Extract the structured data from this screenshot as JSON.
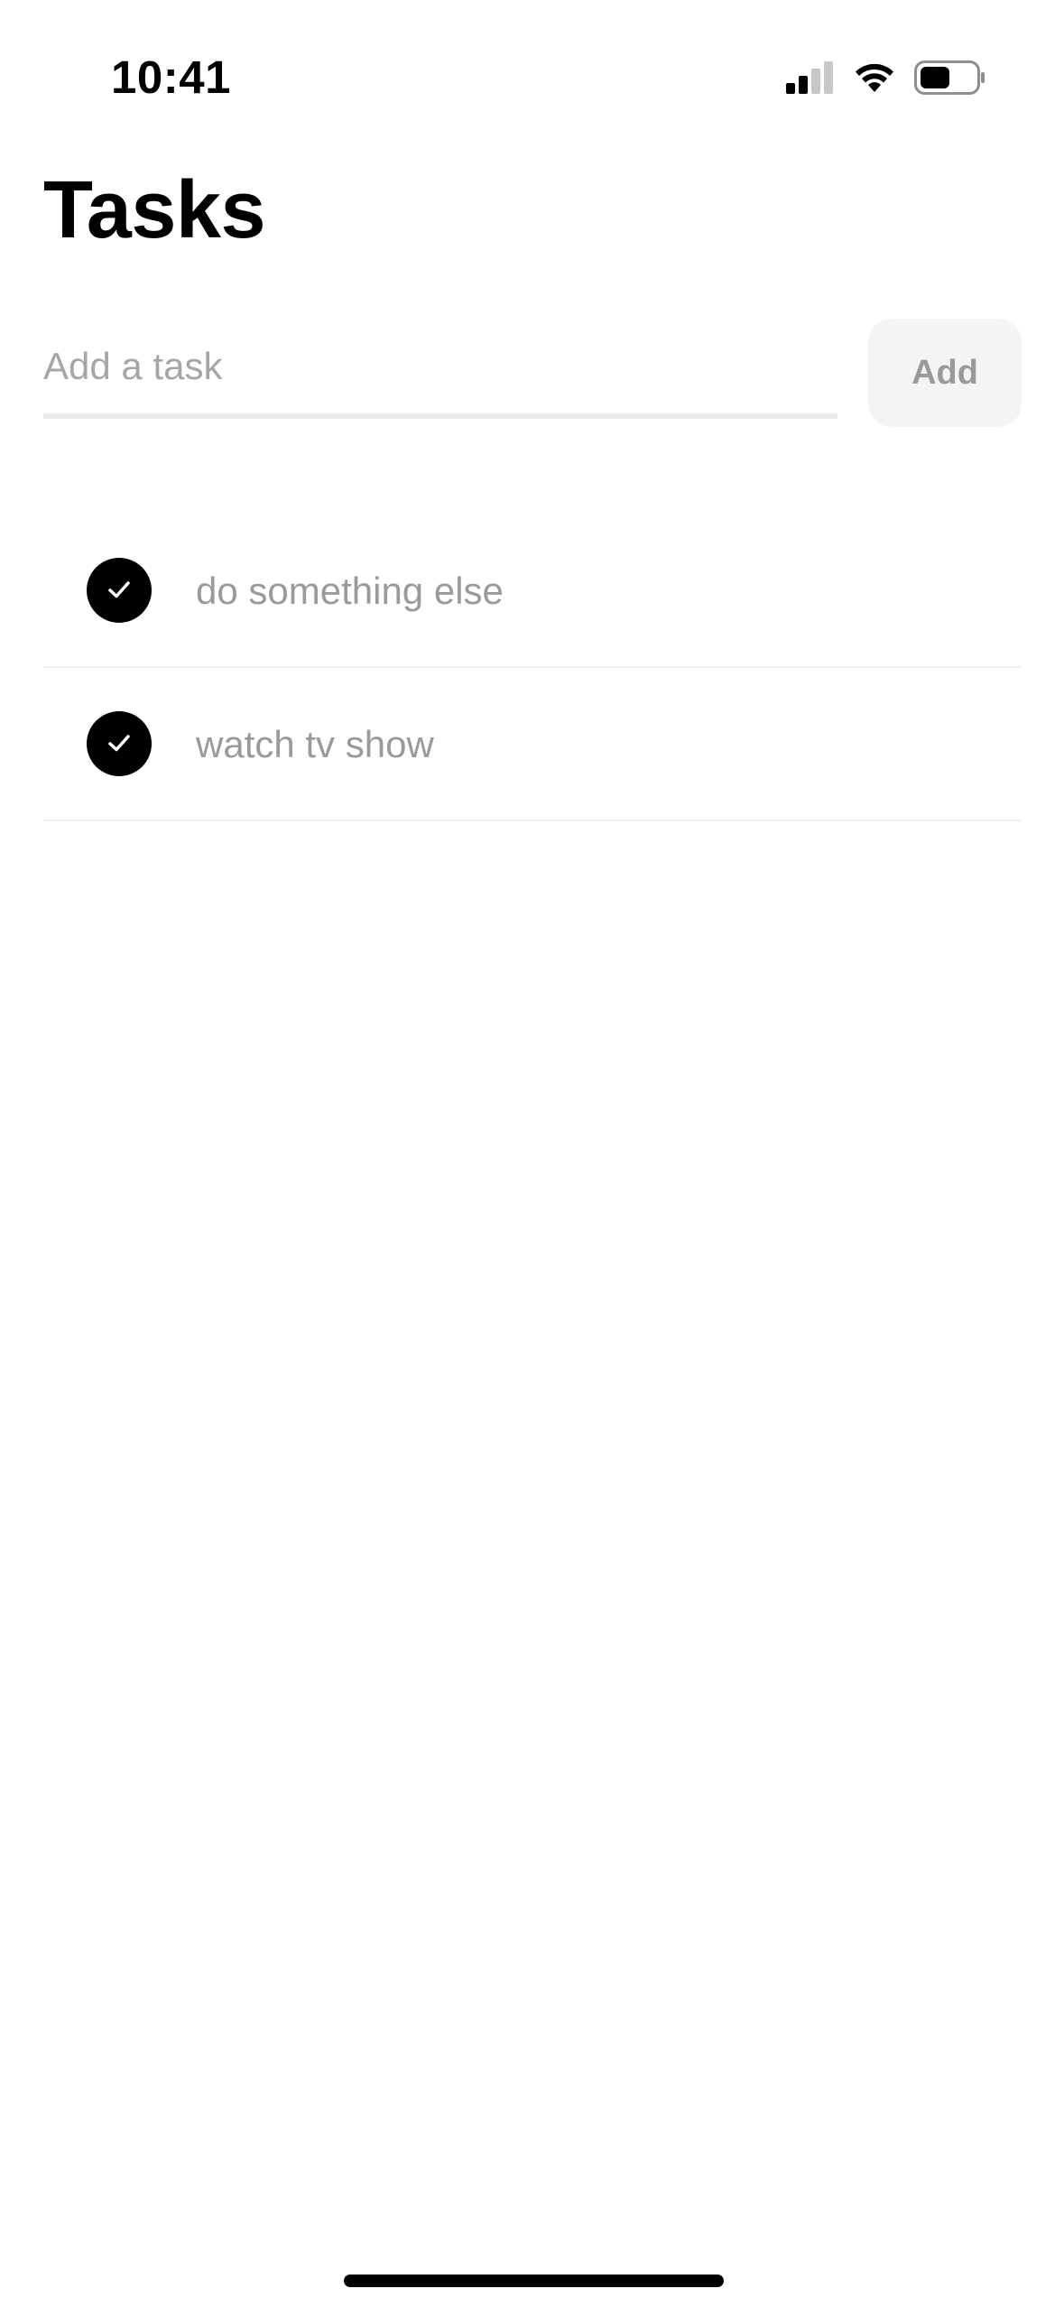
{
  "status_bar": {
    "time": "10:41",
    "icons": [
      "cellular-signal-icon",
      "wifi-icon",
      "battery-icon"
    ]
  },
  "header": {
    "title": "Tasks"
  },
  "add_task": {
    "placeholder": "Add a task",
    "value": "",
    "button_label": "Add"
  },
  "tasks": [
    {
      "text": "do something else",
      "completed": true
    },
    {
      "text": "watch tv show",
      "completed": true
    }
  ],
  "colors": {
    "accent": "#000000",
    "muted_text": "#9a9a9a",
    "button_bg": "#f4f4f4",
    "divider": "#f0f0f0"
  }
}
